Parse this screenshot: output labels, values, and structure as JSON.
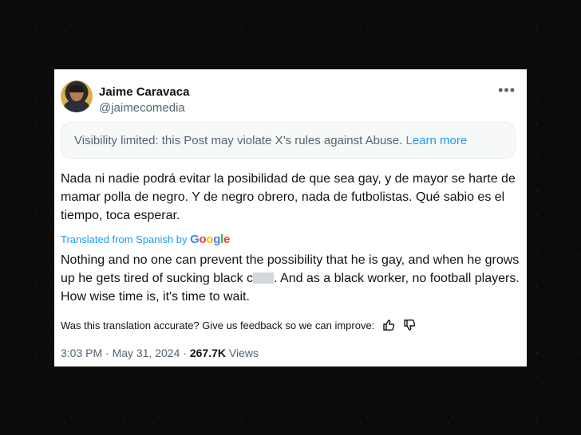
{
  "user": {
    "name": "Jaime Caravaca",
    "handle": "@jaimecomedia",
    "more_glyph": "•••"
  },
  "notice": {
    "text": "Visibility limited: this Post may violate X’s rules against Abuse.",
    "link": "Learn more"
  },
  "post": {
    "original": "Nada ni nadie podrá evitar la posibilidad de que sea gay, y de mayor se harte de mamar polla de negro. Y de negro obrero, nada de futbolistas. Qué sabio es el tiempo, toca esperar.",
    "translated_label": "Translated from Spanish by",
    "google": [
      "G",
      "o",
      "o",
      "g",
      "l",
      "e"
    ],
    "translation_part1": "Nothing and no one can prevent the possibility that he is gay, and when he grows up he gets tired of sucking black c",
    "translation_part2": ". And as a black worker, no football players. How wise time is, it's time to wait."
  },
  "feedback": {
    "text": "Was this translation accurate? Give us feedback so we can improve:"
  },
  "meta": {
    "timestamp": "3:03 PM · May 31, 2024 · ",
    "views_count": "267.7K",
    "views_label": " Views"
  },
  "icons": [
    "more-icon",
    "thumbs-up-icon",
    "thumbs-down-icon"
  ],
  "colors": {
    "link": "#1d9bf0",
    "secondary_text": "#536471",
    "primary_text": "#0f1419"
  }
}
